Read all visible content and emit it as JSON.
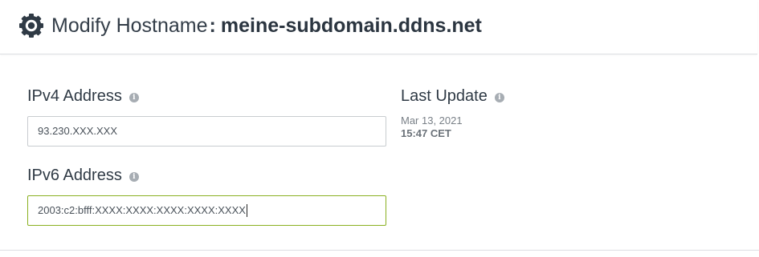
{
  "header": {
    "title_prefix": "Modify Hostname",
    "title_separator": ":",
    "hostname": "meine-subdomain.ddns.net",
    "icon": "gear-icon"
  },
  "ipv4": {
    "label": "IPv4 Address",
    "value": "93.230.XXX.XXX"
  },
  "ipv6": {
    "label": "IPv6 Address",
    "value": "2003:c2:bfff:XXXX:XXXX:XXXX:XXXX:XXXX"
  },
  "last_update": {
    "label": "Last Update",
    "date": "Mar 13, 2021",
    "time": "15:47 CET"
  },
  "info_glyph": "i",
  "colors": {
    "focus_border": "#8ab021",
    "text": "#2f3a45",
    "muted": "#7a8188"
  }
}
